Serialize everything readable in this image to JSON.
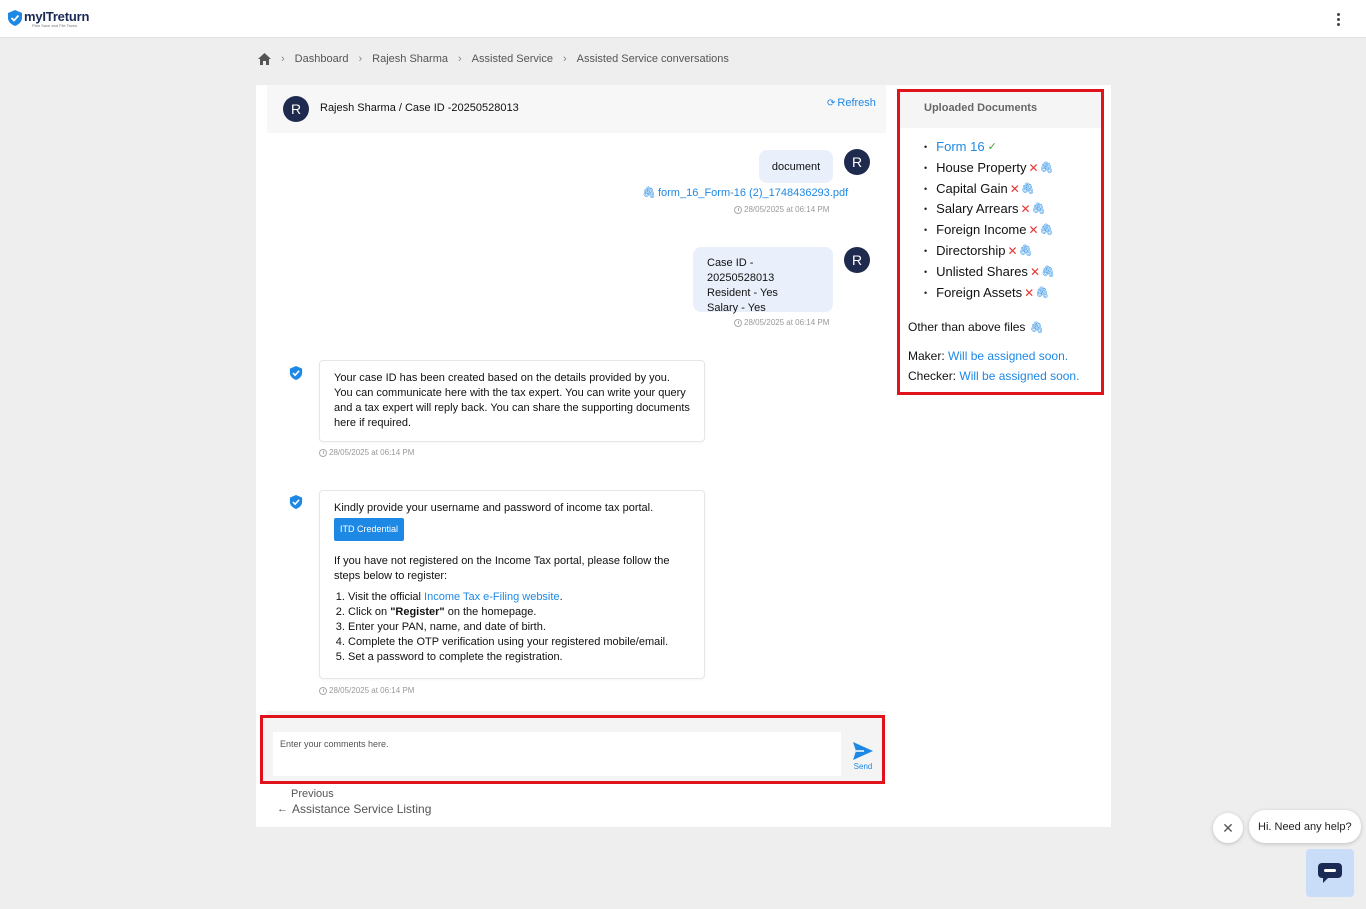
{
  "app": {
    "name": "myITreturn",
    "tagline": "Plan Save and File Taxes"
  },
  "breadcrumb": [
    "Dashboard",
    "Rajesh Sharma",
    "Assisted Service",
    "Assisted Service conversations"
  ],
  "chat": {
    "avatar_letter": "R",
    "title": "Rajesh Sharma / Case ID -20250528013",
    "refresh_label": "Refresh",
    "messages": {
      "m1": {
        "text": "document",
        "file": "form_16_Form-16 (2)_1748436293.pdf",
        "time": "28/05/2025 at 06:14 PM"
      },
      "m2": {
        "line1": "Case ID - 20250528013",
        "line2": "Resident - Yes",
        "line3": "Salary - Yes",
        "time": "28/05/2025 at 06:14 PM"
      },
      "m3": {
        "text": "Your case ID has been created based on the details provided by you. You can communicate here with the tax expert. You can write your query and a tax expert will reply back. You can share the supporting documents here if required.",
        "time": "28/05/2025 at 06:14 PM"
      },
      "m4": {
        "intro": "Kindly provide your username and password of income tax portal.",
        "button": "ITD Credential",
        "para": "If you have not registered on the Income Tax portal, please follow the steps below to register:",
        "step1_pre": "Visit the official ",
        "step1_link": "Income Tax e-Filing website",
        "step1_post": ".",
        "step2_pre": "Click on ",
        "step2_bold": "\"Register\"",
        "step2_post": " on the homepage.",
        "step3": "Enter your PAN, name, and date of birth.",
        "step4": "Complete the OTP verification using your registered mobile/email.",
        "step5": "Set a password to complete the registration.",
        "time": "28/05/2025 at 06:14 PM"
      }
    },
    "composer": {
      "placeholder": "Enter your comments here.",
      "send_label": "Send"
    },
    "previous": {
      "small": "Previous",
      "main": "Assistance Service Listing"
    }
  },
  "docs": {
    "title": "Uploaded Documents",
    "items": [
      {
        "name": "Form 16",
        "status": "uploaded"
      },
      {
        "name": "House Property",
        "status": "missing"
      },
      {
        "name": "Capital Gain",
        "status": "missing"
      },
      {
        "name": "Salary Arrears",
        "status": "missing"
      },
      {
        "name": "Foreign Income",
        "status": "missing"
      },
      {
        "name": "Directorship",
        "status": "missing"
      },
      {
        "name": "Unlisted Shares",
        "status": "missing"
      },
      {
        "name": "Foreign Assets",
        "status": "missing"
      }
    ],
    "other_files": "Other than above files",
    "maker_label": "Maker:",
    "maker_value": "Will be assigned soon.",
    "checker_label": "Checker:",
    "checker_value": "Will be assigned soon."
  },
  "help": {
    "text": "Hi. Need any help?"
  },
  "colors": {
    "accent": "#1e88e5",
    "highlight": "#e0121b",
    "avatar": "#1f2a4f"
  }
}
